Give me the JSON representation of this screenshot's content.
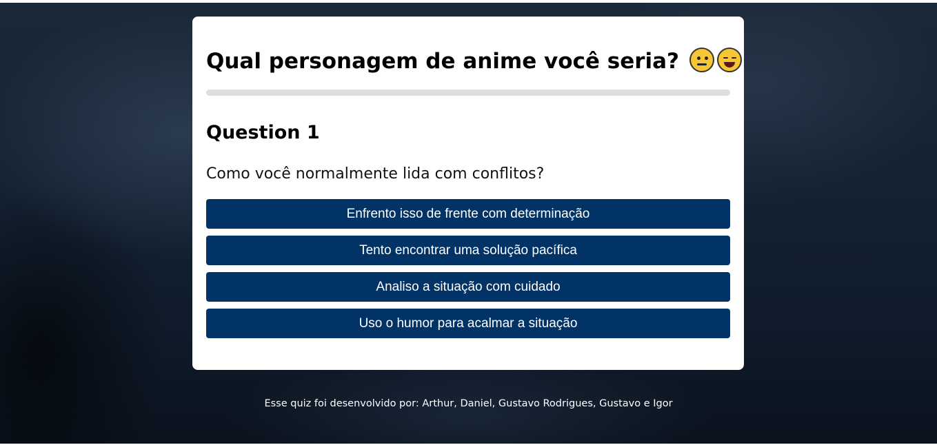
{
  "quiz": {
    "title": "Qual personagem de anime você seria?",
    "title_emojis": [
      "thinking-face-icon",
      "laughing-face-icon"
    ],
    "progress": 0
  },
  "question": {
    "number_label": "Question 1",
    "text": "Como você normalmente lida com conflitos?",
    "answers": [
      "Enfrento isso de frente com determinação",
      "Tento encontrar uma solução pacífica",
      "Analiso a situação com cuidado",
      "Uso o humor para acalmar a situação"
    ]
  },
  "footer": {
    "credits": "Esse quiz foi desenvolvido por: Arthur, Daniel, Gustavo Rodrigues, Gustavo e Igor"
  },
  "colors": {
    "button_bg": "#013366",
    "progress_track": "#dedede",
    "card_bg": "#ffffff"
  }
}
